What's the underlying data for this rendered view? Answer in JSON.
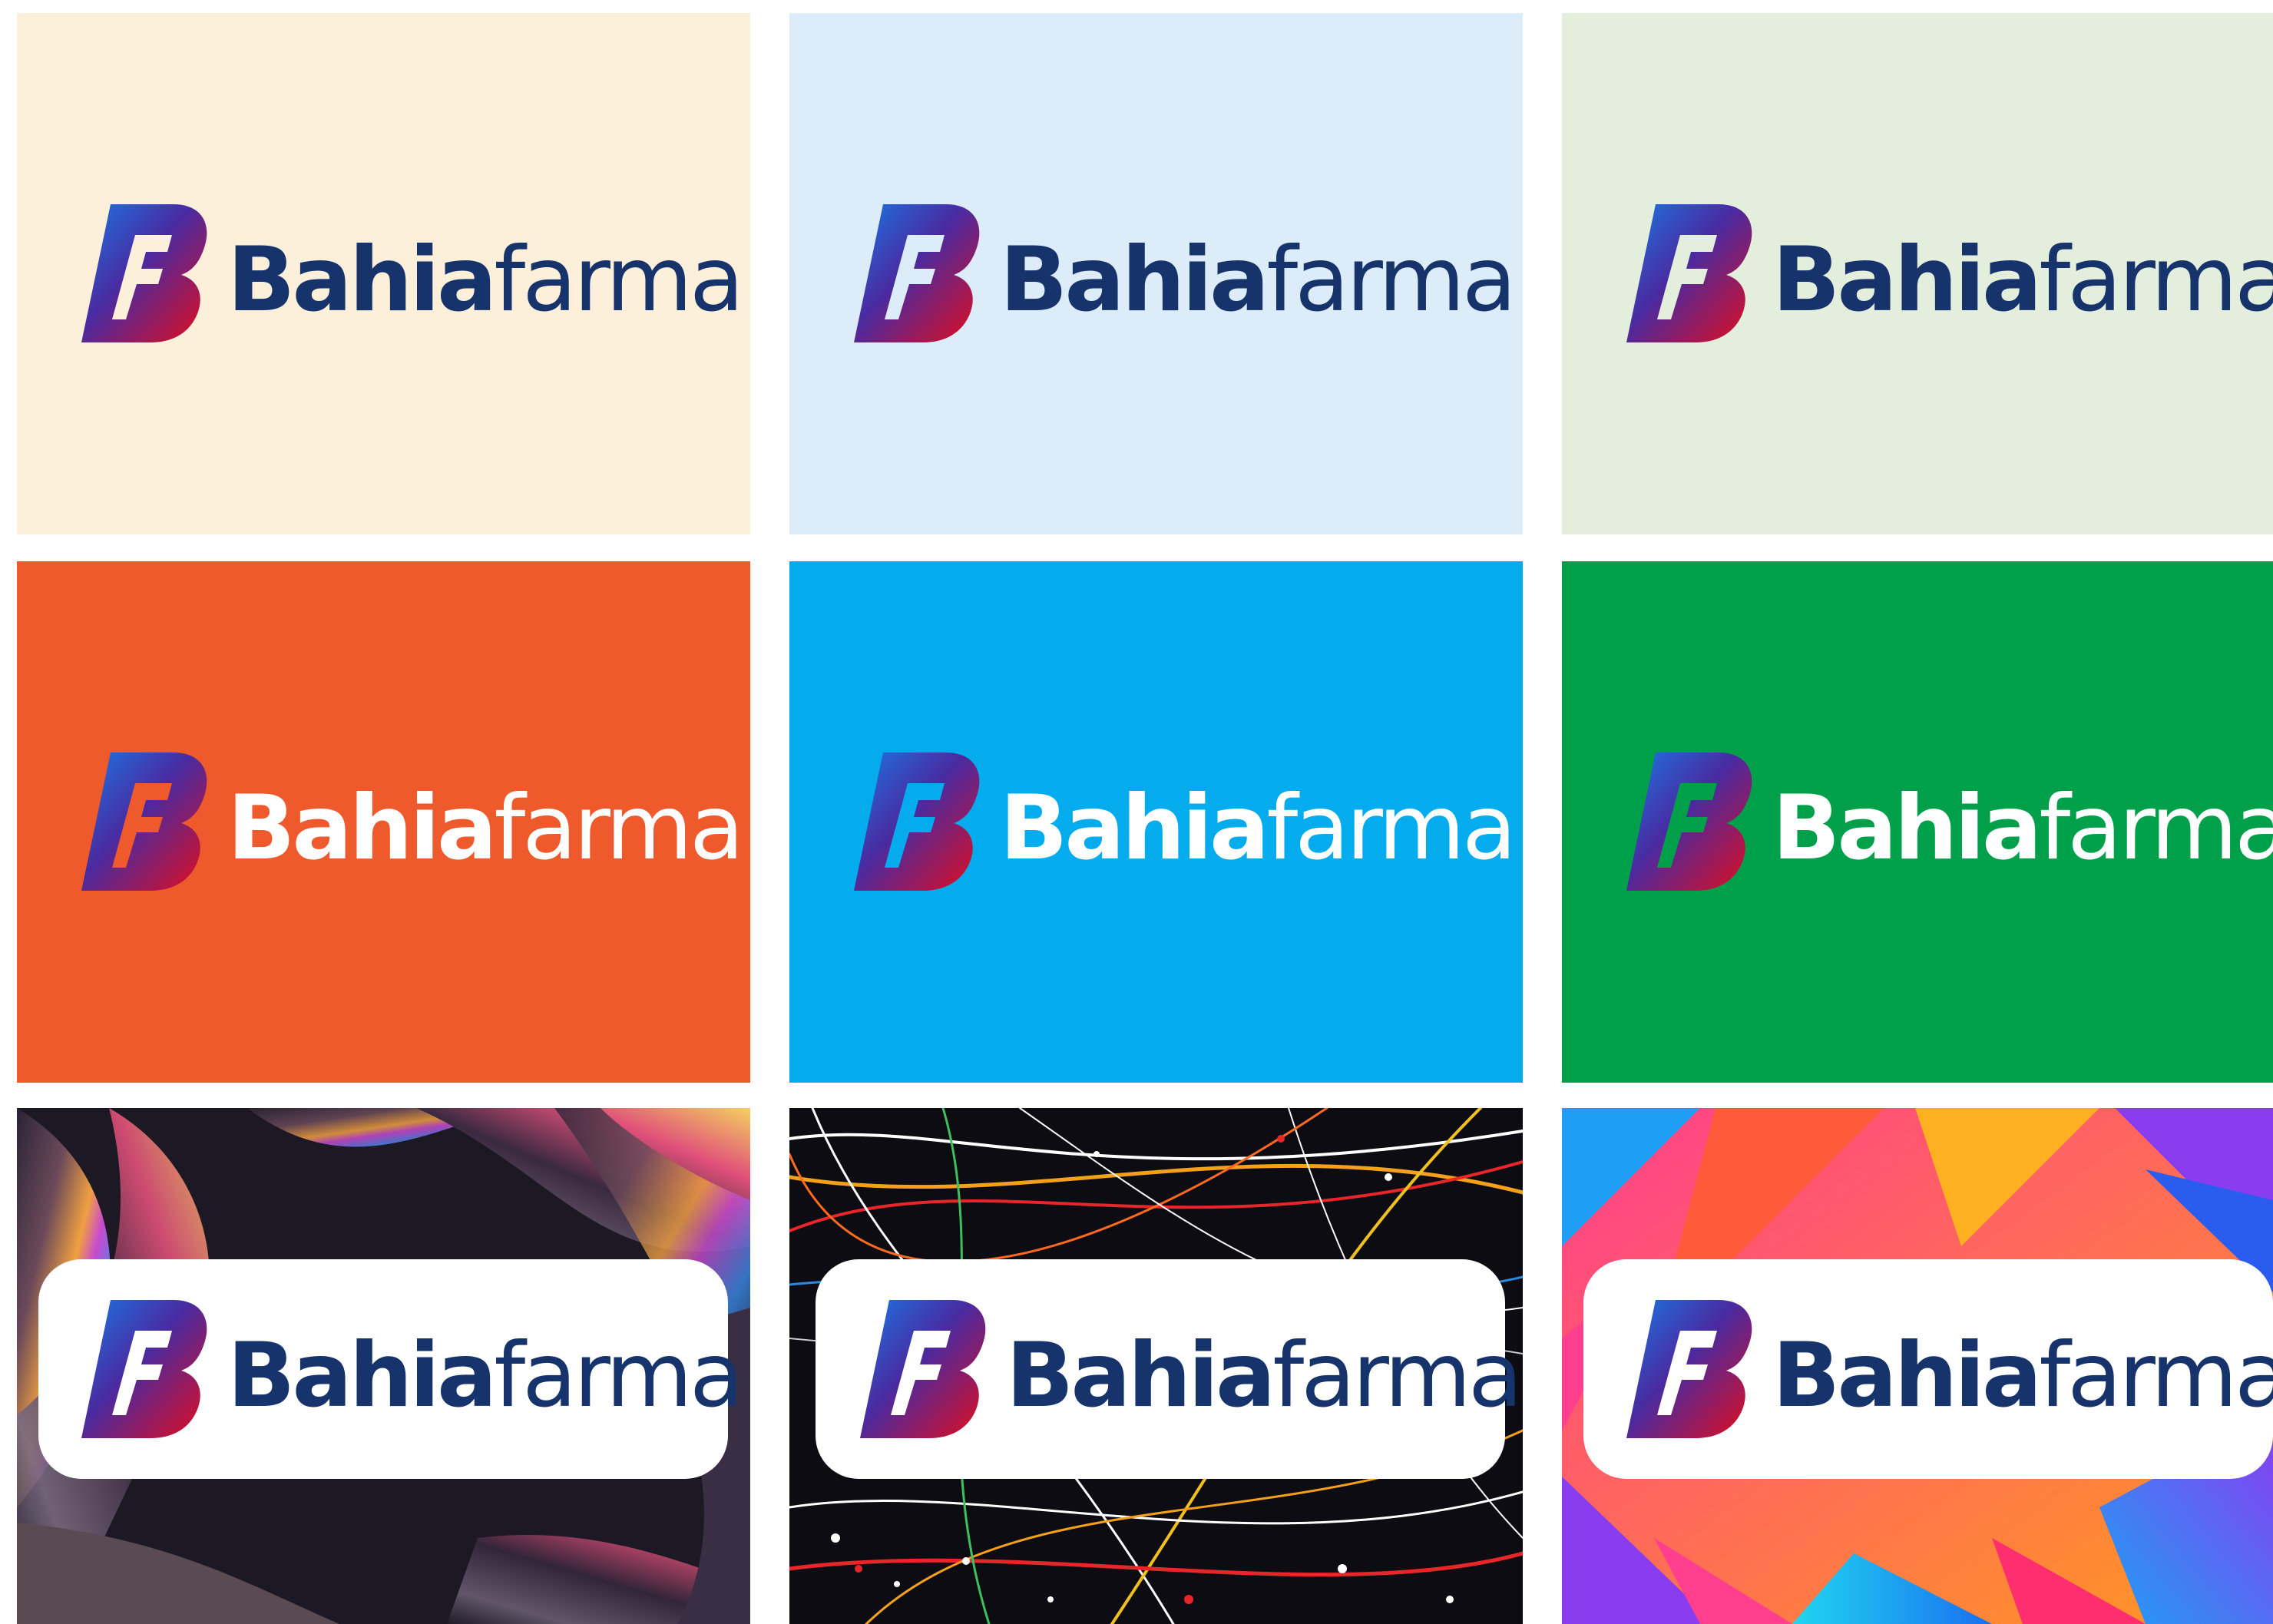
{
  "brand": {
    "name_bold": "Bahia",
    "name_light": "farma",
    "mark_letter": "F",
    "mark_gradient": [
      "#1a6fe0",
      "#5b1a9a",
      "#e00f1f"
    ]
  },
  "tiles": [
    {
      "id": "cream",
      "background": "#fdf0da",
      "text_color": "#17336b",
      "style": "solid"
    },
    {
      "id": "pale-blue",
      "background": "#dcedf9",
      "text_color": "#17336b",
      "style": "solid"
    },
    {
      "id": "pale-green",
      "background": "#e4eedd",
      "text_color": "#17336b",
      "style": "solid"
    },
    {
      "id": "orange",
      "background": "#ef5a2d",
      "text_color": "#ffffff",
      "style": "solid"
    },
    {
      "id": "sky-blue",
      "background": "#04aced",
      "text_color": "#ffffff",
      "style": "solid"
    },
    {
      "id": "green",
      "background": "#00a04b",
      "text_color": "#ffffff",
      "style": "solid"
    },
    {
      "id": "iridescent",
      "background": "abstract-iridescent-3d",
      "text_color": "#17336b",
      "style": "white-box"
    },
    {
      "id": "splatter",
      "background": "paint-splatter",
      "text_color": "#17336b",
      "style": "white-box"
    },
    {
      "id": "geometric",
      "background": "geometric-gradient",
      "text_color": "#17336b",
      "style": "white-box"
    }
  ]
}
